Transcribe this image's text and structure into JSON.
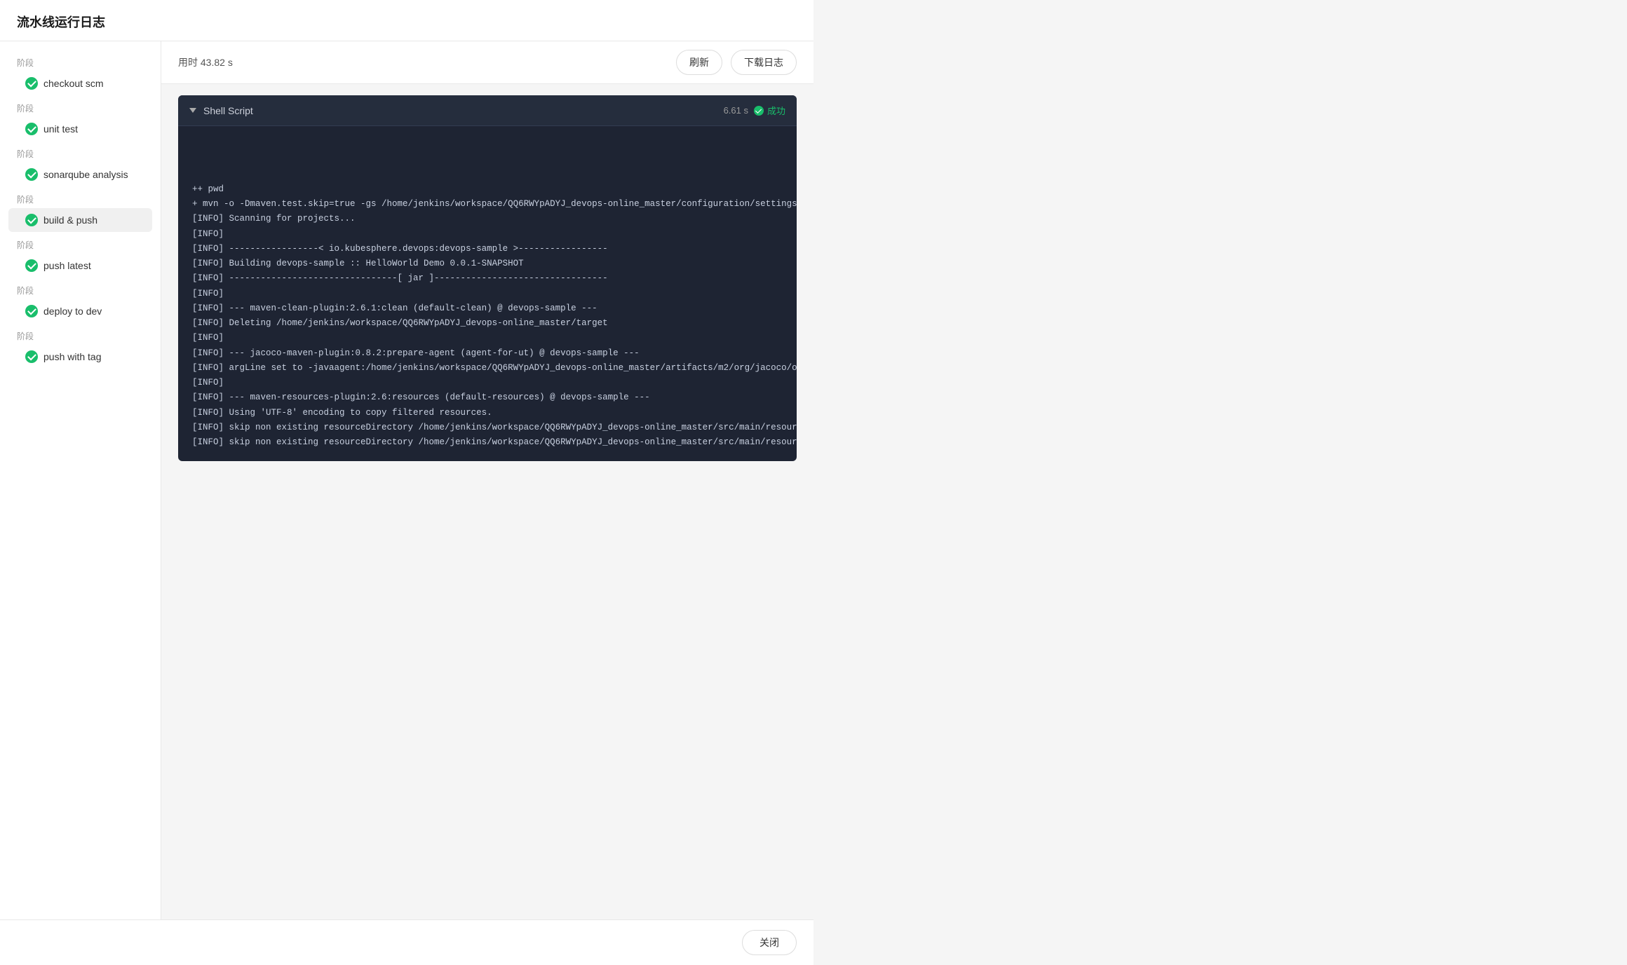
{
  "page": {
    "title": "流水线运行日志"
  },
  "header": {
    "duration_label": "用时 43.82 s",
    "refresh_btn": "刷新",
    "download_btn": "下载日志"
  },
  "sidebar": {
    "stages": [
      {
        "label": "阶段",
        "item": "checkout scm",
        "active": false
      },
      {
        "label": "阶段",
        "item": "unit test",
        "active": false
      },
      {
        "label": "阶段",
        "item": "sonarqube analysis",
        "active": false
      },
      {
        "label": "阶段",
        "item": "build & push",
        "active": true
      },
      {
        "label": "阶段",
        "item": "push latest",
        "active": false
      },
      {
        "label": "阶段",
        "item": "deploy to dev",
        "active": false
      },
      {
        "label": "阶段",
        "item": "push with tag",
        "active": false
      }
    ]
  },
  "log_block": {
    "title": "Shell Script",
    "duration": "6.61 s",
    "status": "成功",
    "lines": [
      "++ pwd",
      "+ mvn -o -Dmaven.test.skip=true -gs /home/jenkins/workspace/QQ6RWYpADYJ_devops-online_master/configuration/settings.xml clean pac",
      "[INFO] Scanning for projects...",
      "[INFO]",
      "[INFO] -----------------< io.kubesphere.devops:devops-sample >-----------------",
      "[INFO] Building devops-sample :: HelloWorld Demo 0.0.1-SNAPSHOT",
      "[INFO] --------------------------------[ jar ]---------------------------------",
      "[INFO]",
      "[INFO] --- maven-clean-plugin:2.6.1:clean (default-clean) @ devops-sample ---",
      "[INFO] Deleting /home/jenkins/workspace/QQ6RWYpADYJ_devops-online_master/target",
      "[INFO]",
      "[INFO] --- jacoco-maven-plugin:0.8.2:prepare-agent (agent-for-ut) @ devops-sample ---",
      "[INFO] argLine set to -javaagent:/home/jenkins/workspace/QQ6RWYpADYJ_devops-online_master/artifacts/m2/org/jacoco/org.jacoco.agent",
      "[INFO]",
      "[INFO] --- maven-resources-plugin:2.6:resources (default-resources) @ devops-sample ---",
      "[INFO] Using 'UTF-8' encoding to copy filtered resources.",
      "[INFO] skip non existing resourceDirectory /home/jenkins/workspace/QQ6RWYpADYJ_devops-online_master/src/main/resources",
      "[INFO] skip non existing resourceDirectory /home/jenkins/workspace/QQ6RWYpADYJ_devops-online_master/src/main/resources"
    ]
  },
  "footer": {
    "close_btn": "关闭"
  }
}
